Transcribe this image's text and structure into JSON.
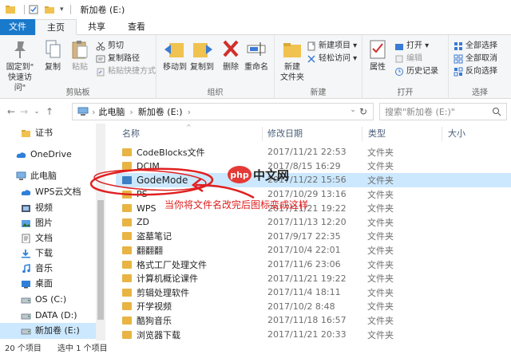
{
  "titlebar": {
    "title": "新加卷 (E:)",
    "quick_access_sep": "|",
    "dropdown": "▾"
  },
  "tabs": [
    {
      "label": "文件"
    },
    {
      "label": "主页"
    },
    {
      "label": "共享"
    },
    {
      "label": "查看"
    }
  ],
  "ribbon": {
    "clipboard": {
      "label": "剪贴板",
      "pin": "固定到\"快速访问\"",
      "pin_line1": "固定到\"",
      "pin_line2": "快速访问\"",
      "copy": "复制",
      "paste": "粘贴",
      "cut": "剪切",
      "copy_path": "复制路径",
      "paste_shortcut": "粘贴快捷方式"
    },
    "organize": {
      "label": "组织",
      "move_to": "移动到",
      "copy_to": "复制到",
      "delete": "删除",
      "rename": "重命名"
    },
    "new": {
      "label": "新建",
      "new_folder_line1": "新建",
      "new_folder_line2": "文件夹",
      "new_item": "新建项目 ▾",
      "easy_access": "轻松访问 ▾"
    },
    "open": {
      "label": "打开",
      "properties": "属性",
      "open": "打开 ▾",
      "edit": "编辑",
      "history": "历史记录"
    },
    "select": {
      "label": "选择",
      "select_all": "全部选择",
      "select_none": "全部取消",
      "invert": "反向选择"
    }
  },
  "nav": {
    "back": "←",
    "forward": "→",
    "recent": "⌄",
    "up": "↑",
    "breadcrumb": [
      "此电脑",
      "新加卷 (E:)"
    ],
    "breadcrumb_sep": "›",
    "address_dropdown": "⌄",
    "refresh": "↻",
    "search_placeholder": "搜索\"新加卷 (E:)\""
  },
  "sidebar": {
    "items": [
      {
        "label": "证书",
        "icon": "folder-icon"
      },
      {
        "label": "OneDrive",
        "icon": "cloud-icon"
      },
      {
        "label": "此电脑",
        "icon": "computer-icon"
      },
      {
        "label": "WPS云文档",
        "icon": "cloud-icon"
      },
      {
        "label": "视频",
        "icon": "video-icon"
      },
      {
        "label": "图片",
        "icon": "picture-icon"
      },
      {
        "label": "文档",
        "icon": "document-icon"
      },
      {
        "label": "下载",
        "icon": "download-icon"
      },
      {
        "label": "音乐",
        "icon": "music-icon"
      },
      {
        "label": "桌面",
        "icon": "desktop-icon"
      },
      {
        "label": "OS (C:)",
        "icon": "drive-icon"
      },
      {
        "label": "DATA (D:)",
        "icon": "drive-icon"
      },
      {
        "label": "新加卷 (E:)",
        "icon": "drive-icon",
        "selected": true
      }
    ]
  },
  "filelist": {
    "columns": [
      "名称",
      "修改日期",
      "类型",
      "大小"
    ],
    "sort_indicator": "^",
    "rows": [
      {
        "name": "CodeBlocks文件",
        "date": "2017/11/21 22:53",
        "type": "文件夹"
      },
      {
        "name": "DCIM",
        "date": "2017/8/15 16:29",
        "type": "文件夹"
      },
      {
        "name": "GodeMode",
        "date": "2017/11/22 15:56",
        "type": "文件夹",
        "selected": true,
        "special": true
      },
      {
        "name": "PS",
        "date": "2017/10/29 13:16",
        "type": "文件夹"
      },
      {
        "name": "WPS",
        "date": "2017/11/21 19:22",
        "type": "文件夹"
      },
      {
        "name": "ZD",
        "date": "2017/11/13 12:20",
        "type": "文件夹"
      },
      {
        "name": "盗墓笔记",
        "date": "2017/9/17 22:35",
        "type": "文件夹"
      },
      {
        "name": "翻翻翻",
        "date": "2017/10/4 22:01",
        "type": "文件夹"
      },
      {
        "name": "格式工厂处理文件",
        "date": "2017/11/6 23:06",
        "type": "文件夹"
      },
      {
        "name": "计算机概论课件",
        "date": "2017/11/21 19:22",
        "type": "文件夹"
      },
      {
        "name": "剪辑处理软件",
        "date": "2017/11/4 18:11",
        "type": "文件夹"
      },
      {
        "name": "开学视频",
        "date": "2017/10/2 8:48",
        "type": "文件夹"
      },
      {
        "name": "酷狗音乐",
        "date": "2017/11/18 16:57",
        "type": "文件夹"
      },
      {
        "name": "浏览器下载",
        "date": "2017/11/21 20:33",
        "type": "文件夹"
      }
    ]
  },
  "statusbar": {
    "count": "20 个项目",
    "selected": "选中 1 个项目"
  },
  "annotation": {
    "text": "当你将文件名改完后图标变成这样",
    "logo_badge": "php",
    "logo_text": "中文网",
    "color": "#e02020"
  }
}
